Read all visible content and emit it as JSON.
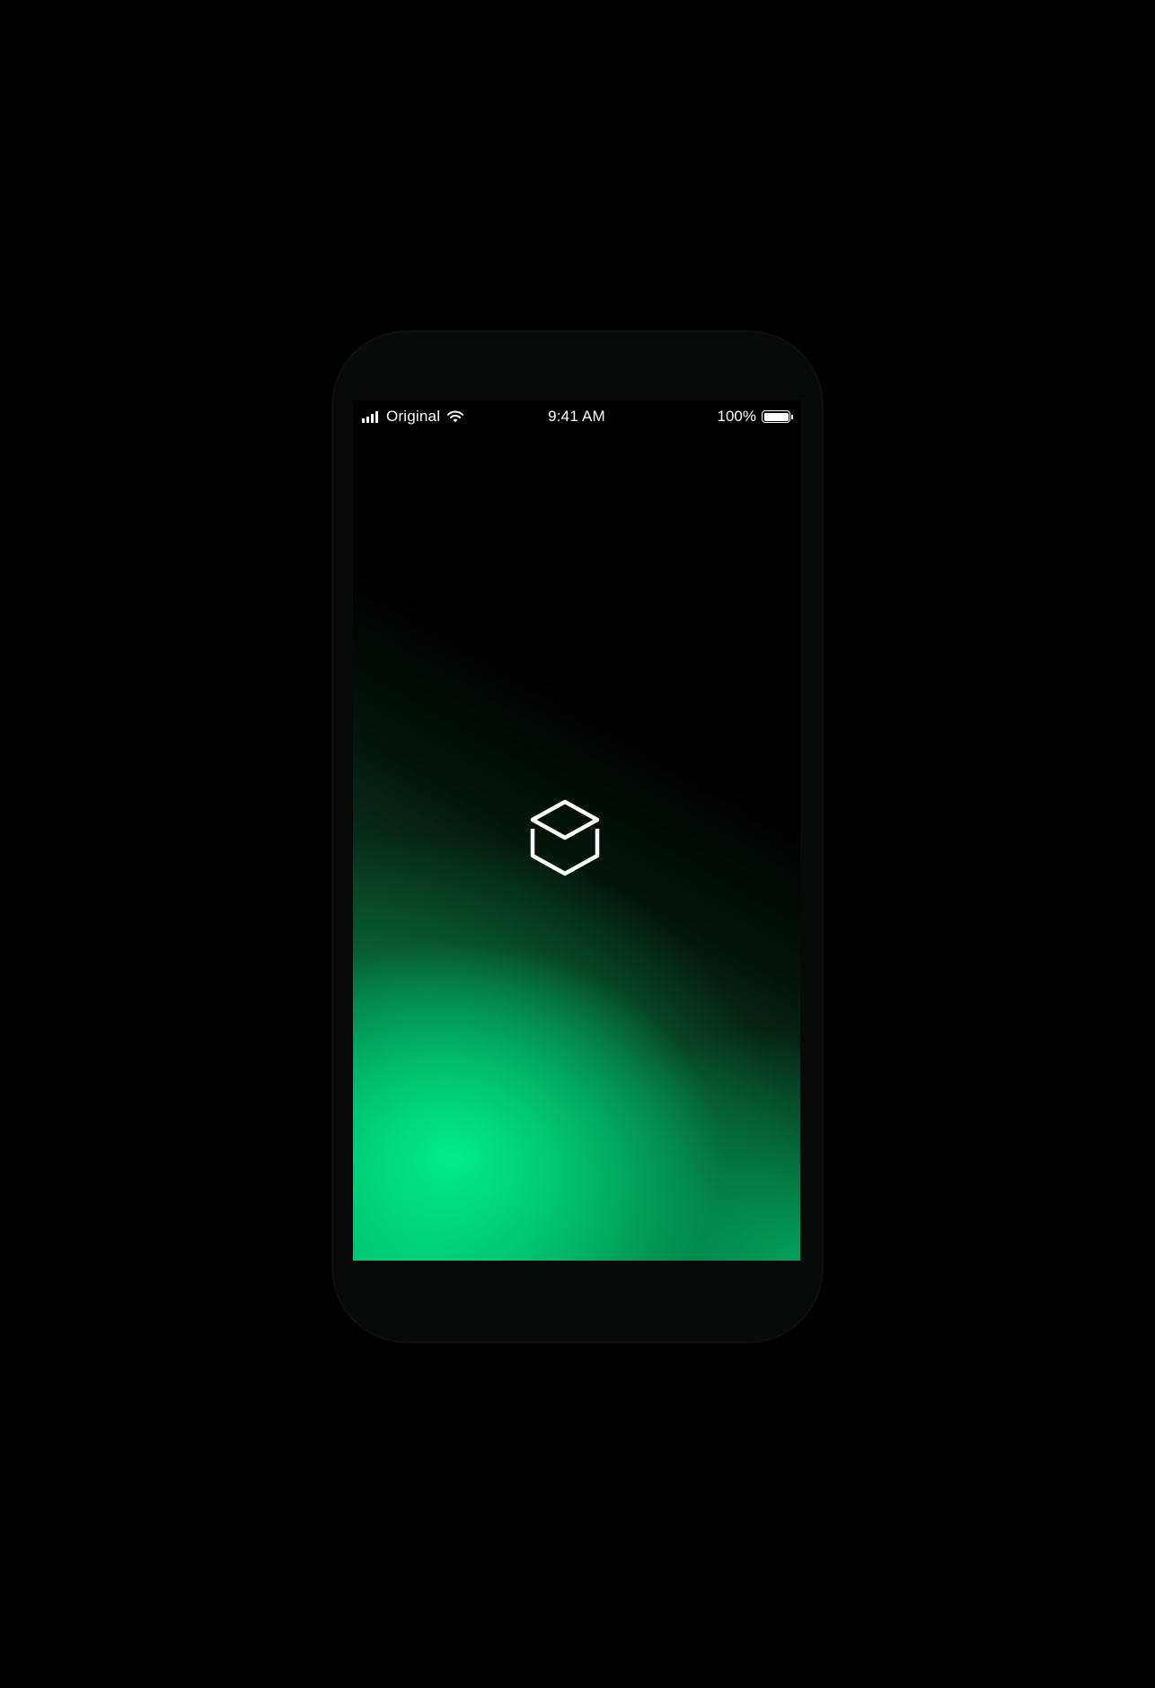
{
  "status_bar": {
    "carrier": "Original",
    "time": "9:41 AM",
    "battery_percent": "100%",
    "battery_level": 1.0,
    "signal_bars": 4
  },
  "splash": {
    "logo_icon": "cube-outline-icon",
    "logo_color": "#ffffff"
  },
  "colors": {
    "background": "#000000",
    "phone_bezel": "#080909",
    "accent_green": "#00e887"
  }
}
